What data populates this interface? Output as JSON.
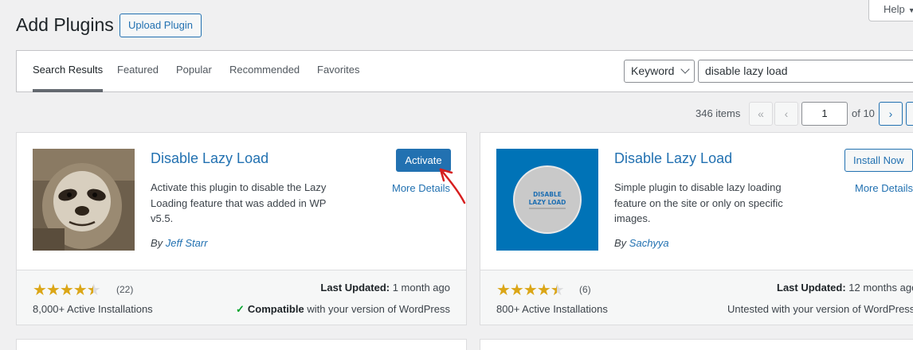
{
  "header": {
    "title": "Add Plugins",
    "upload_label": "Upload Plugin",
    "help_label": "Help"
  },
  "tabs": [
    {
      "label": "Search Results",
      "active": true
    },
    {
      "label": "Featured"
    },
    {
      "label": "Popular"
    },
    {
      "label": "Recommended"
    },
    {
      "label": "Favorites"
    }
  ],
  "search": {
    "type_label": "Keyword",
    "query": "disable lazy load"
  },
  "pagination": {
    "items": "346 items",
    "first": "«",
    "prev": "‹",
    "current": "1",
    "of_pages": "of 10",
    "next": "›"
  },
  "plugins": [
    {
      "name": "Disable Lazy Load",
      "description": "Activate this plugin to disable the Lazy Loading feature that was added in WP v5.5.",
      "by": "By",
      "author": "Jeff Starr",
      "action_label": "Activate",
      "more_label": "More Details",
      "rating_count": "(22)",
      "stars": 4.5,
      "installs": "8,000+ Active Installations",
      "last_updated_label": "Last Updated:",
      "last_updated_value": "1 month ago",
      "compat_bold": "Compatible",
      "compat_rest": "with your version of WordPress"
    },
    {
      "name": "Disable Lazy Load",
      "description": "Simple plugin to disable lazy loading feature on the site or only on specific images.",
      "by": "By",
      "author": "Sachyya",
      "action_label": "Install Now",
      "more_label": "More Details",
      "rating_count": "(6)",
      "stars": 4.5,
      "installs": "800+ Active Installations",
      "last_updated_label": "Last Updated:",
      "last_updated_value": "12 months ago",
      "compat_text": "Untested with your version of WordPress",
      "logo_text_1": "DISABLE",
      "logo_text_2": "LAZY LOAD"
    }
  ],
  "colors": {
    "accent": "#2271b1",
    "star": "#dba617",
    "check": "#00a32a",
    "logo_bg": "#0073b7"
  }
}
